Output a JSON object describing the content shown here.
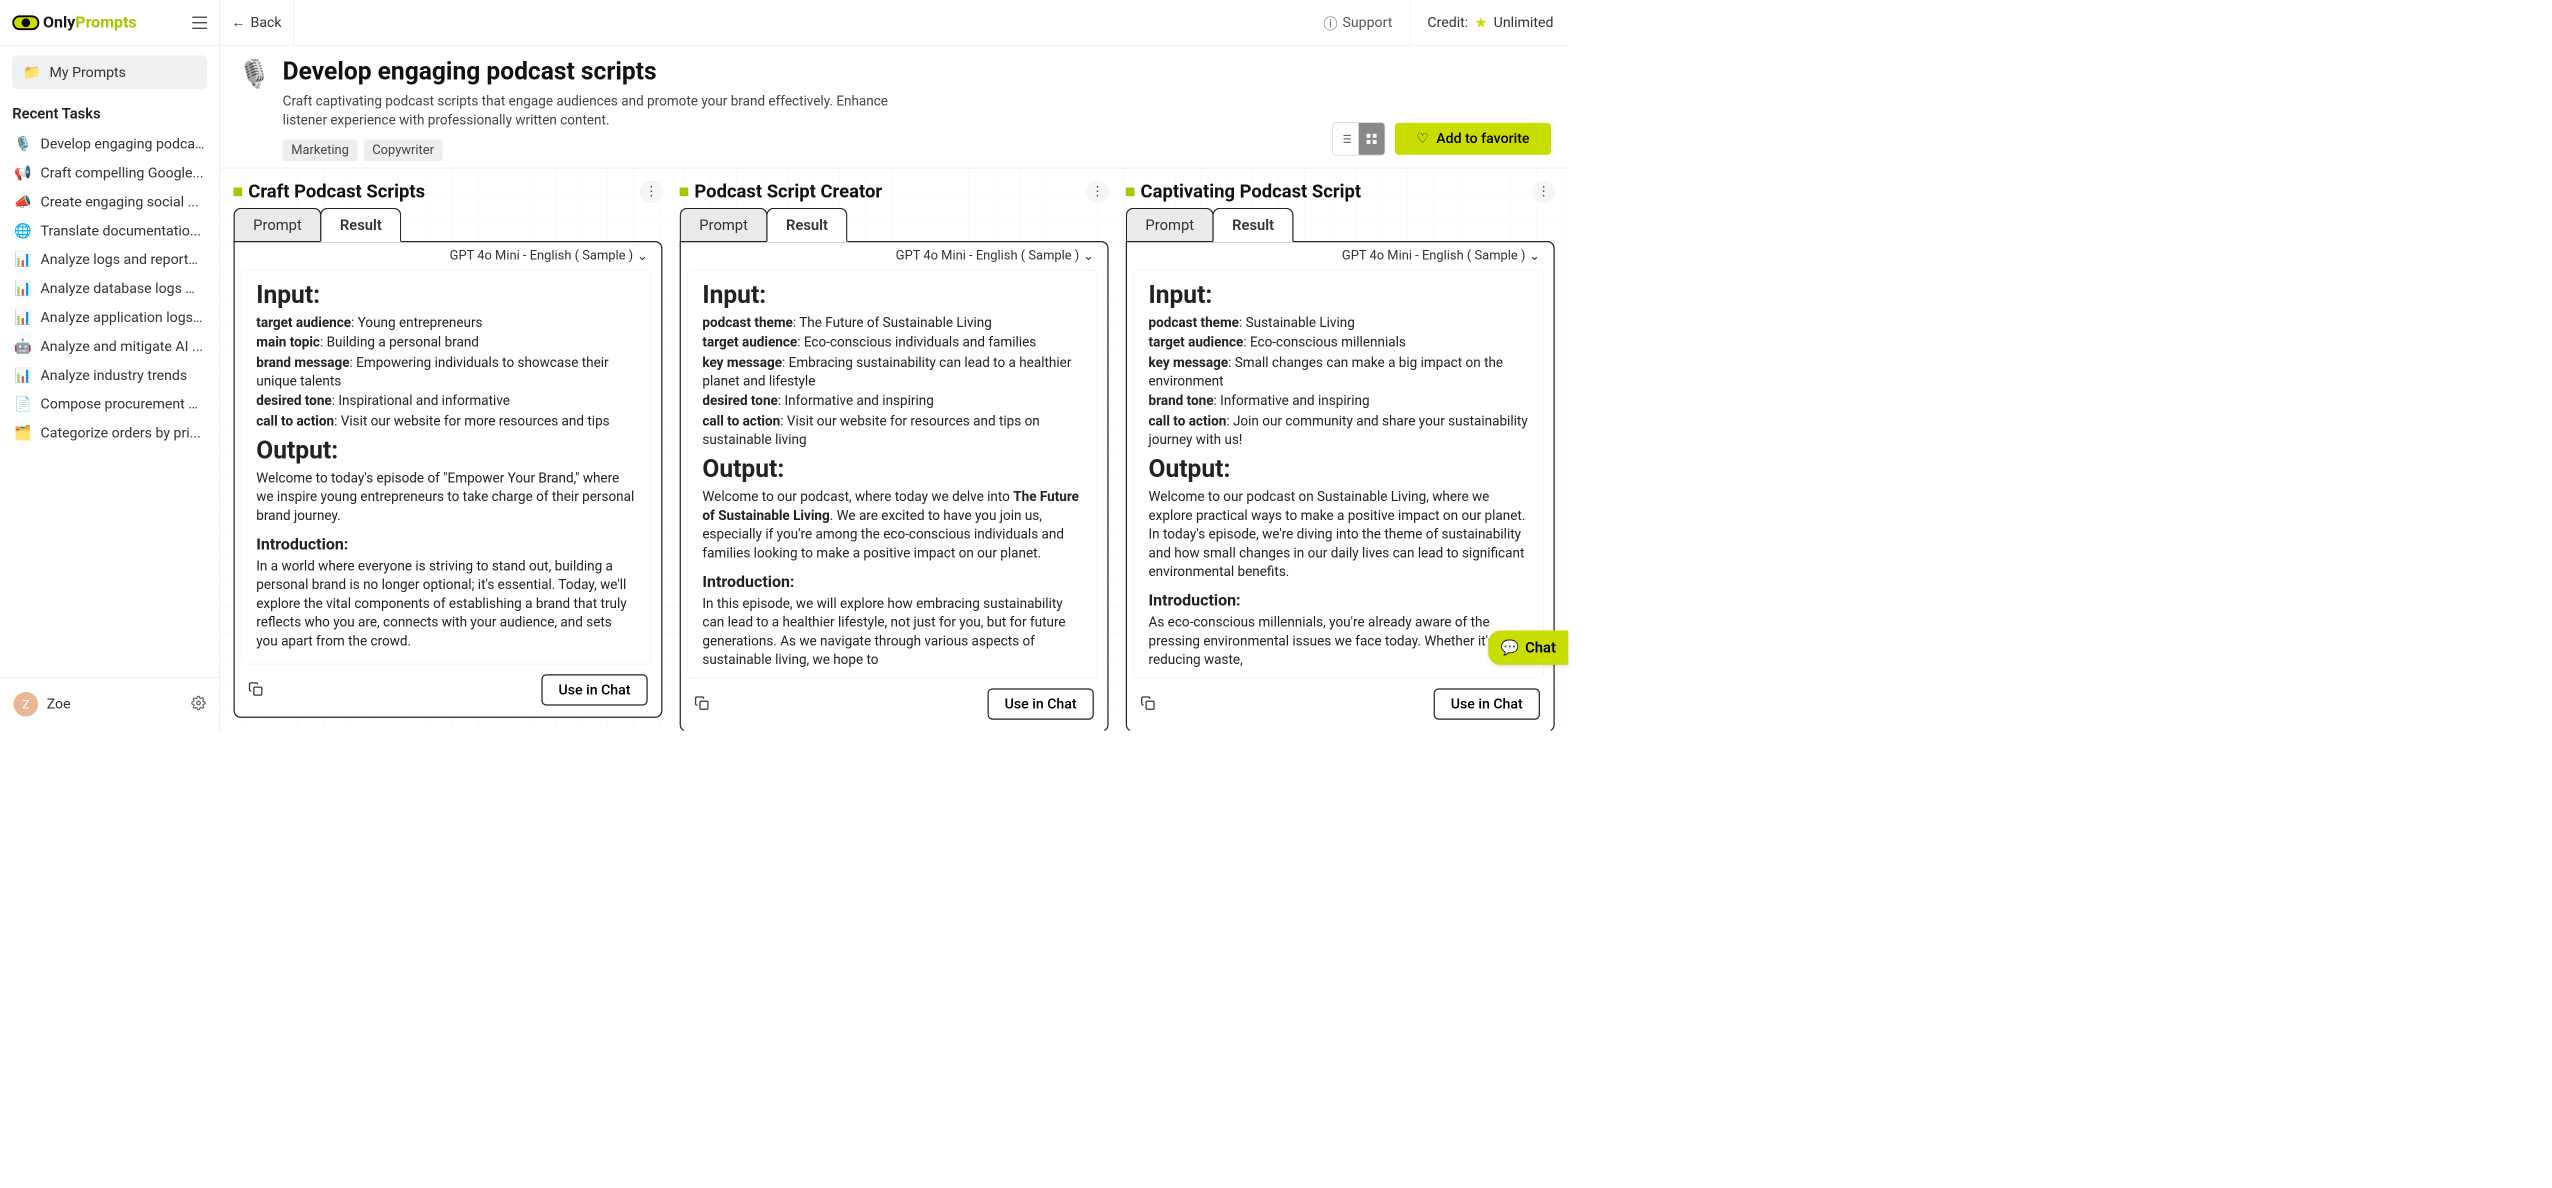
{
  "brand": {
    "name_left": "Only",
    "name_right": "Prompts"
  },
  "topbar": {
    "back": "Back",
    "support": "Support",
    "credit_label": "Credit:",
    "credit_value": "Unlimited"
  },
  "sidebar": {
    "my_prompts": "My Prompts",
    "recent_heading": "Recent Tasks",
    "items": [
      {
        "icon": "🎙️",
        "label": "Develop engaging podcas..."
      },
      {
        "icon": "📢",
        "label": "Craft compelling Google..."
      },
      {
        "icon": "📣",
        "label": "Create engaging social ..."
      },
      {
        "icon": "🌐",
        "label": "Translate documentatio..."
      },
      {
        "icon": "📊",
        "label": "Analyze logs and reports ..."
      },
      {
        "icon": "📊",
        "label": "Analyze database logs wi..."
      },
      {
        "icon": "📊",
        "label": "Analyze application logs ..."
      },
      {
        "icon": "🤖",
        "label": "Analyze and mitigate AI ..."
      },
      {
        "icon": "📊",
        "label": "Analyze industry trends"
      },
      {
        "icon": "📄",
        "label": "Compose procurement p..."
      },
      {
        "icon": "🗂️",
        "label": "Categorize orders by pri..."
      }
    ],
    "user_initial": "Z",
    "user_name": "Zoe"
  },
  "header": {
    "icon": "🎙️",
    "title": "Develop engaging podcast scripts",
    "subtitle": "Craft captivating podcast scripts that engage audiences and promote your brand effectively. Enhance listener experience with professionally written content.",
    "tags": [
      "Marketing",
      "Copywriter"
    ],
    "fav_label": "Add to favorite"
  },
  "common": {
    "prompt_tab": "Prompt",
    "result_tab": "Result",
    "model": "GPT 4o Mini - English ( Sample )",
    "input_h": "Input:",
    "output_h": "Output:",
    "intro_h": "Introduction:",
    "use": "Use in Chat"
  },
  "chat_label": "Chat",
  "cards": [
    {
      "title": "Craft Podcast Scripts",
      "inputs": [
        [
          "target audience",
          "Young entrepreneurs"
        ],
        [
          "main topic",
          "Building a personal brand"
        ],
        [
          "brand message",
          "Empowering individuals to showcase their unique talents"
        ],
        [
          "desired tone",
          "Inspirational and informative"
        ],
        [
          "call to action",
          "Visit our website for more resources and tips"
        ]
      ],
      "out_p1": "Welcome to today's episode of \"Empower Your Brand,\" where we inspire young entrepreneurs to take charge of their personal brand journey.",
      "intro": "In a world where everyone is striving to stand out, building a personal brand is no longer optional; it's essential. Today, we'll explore the vital components of establishing a brand that truly reflects who you are, connects with your audience, and sets you apart from the crowd."
    },
    {
      "title": "Podcast Script Creator",
      "inputs": [
        [
          "podcast theme",
          "The Future of Sustainable Living"
        ],
        [
          "target audience",
          "Eco-conscious individuals and families"
        ],
        [
          "key message",
          "Embracing sustainability can lead to a healthier planet and lifestyle"
        ],
        [
          "desired tone",
          "Informative and inspiring"
        ],
        [
          "call to action",
          "Visit our website for resources and tips on sustainable living"
        ]
      ],
      "out_pref": "Welcome to our podcast, where today we delve into ",
      "out_bold": "The Future of Sustainable Living",
      "out_suff": ". We are excited to have you join us, especially if you're among the eco-conscious individuals and families looking to make a positive impact on our planet.",
      "intro": "In this episode, we will explore how embracing sustainability can lead to a healthier lifestyle, not just for you, but for future generations. As we navigate through various aspects of sustainable living, we hope to"
    },
    {
      "title": "Captivating Podcast Script",
      "inputs": [
        [
          "podcast theme",
          "Sustainable Living"
        ],
        [
          "target audience",
          "Eco-conscious millennials"
        ],
        [
          "key message",
          "Small changes can make a big impact on the environment"
        ],
        [
          "brand tone",
          "Informative and inspiring"
        ],
        [
          "call to action",
          "Join our community and share your sustainability journey with us!"
        ]
      ],
      "out_p1": "Welcome to our podcast on Sustainable Living, where we explore practical ways to make a positive impact on our planet. In today's episode, we're diving into the theme of sustainability and how small changes in our daily lives can lead to significant environmental benefits.",
      "intro": "As eco-conscious millennials, you're already aware of the pressing environmental issues we face today. Whether it's reducing waste,"
    }
  ]
}
